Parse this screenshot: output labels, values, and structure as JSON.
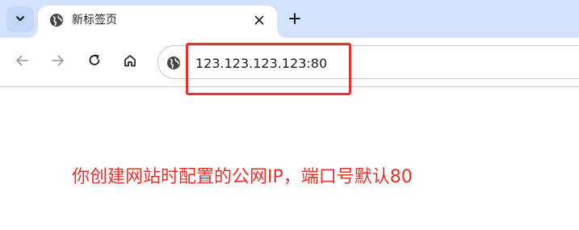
{
  "browser": {
    "tab": {
      "title": "新标签页"
    },
    "address_bar": {
      "value": "123.123.123.123:80"
    }
  },
  "annotation": {
    "text": "你创建网站时配置的公网IP，端口号默认80"
  },
  "colors": {
    "tabstrip_bg": "#d3e3fd",
    "annotation_red": "#e8312a",
    "icon_gray": "#474747"
  }
}
